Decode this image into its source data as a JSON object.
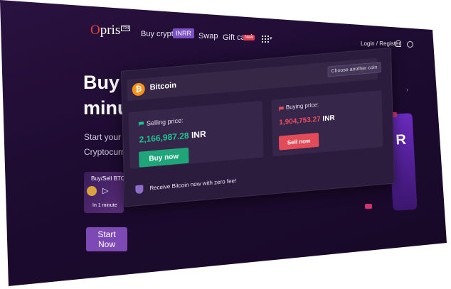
{
  "brand": {
    "logo_first": "O",
    "logo_rest": "pris",
    "logo_tm": "TM"
  },
  "nav": {
    "buy_crypto": "Buy crypto",
    "buy_badge": "INRR",
    "swap": "Swap",
    "gift_card": "Gift card",
    "gift_badge": "New",
    "apps_caret": "▾",
    "login": "Login / Register"
  },
  "hero": {
    "title_line1": "Buy so",
    "title_line2": "minute",
    "sub_line1": "Start your jou",
    "sub_line2": "Cryptocurren",
    "promo_top": "Buy/Sell BTC",
    "promo_bottom": "In 1 minute",
    "start_button": "Start Now"
  },
  "panel": {
    "coin_name": "Bitcoin",
    "coin_symbol": "₿",
    "choose_button": "Choose another coin",
    "selling": {
      "label": "Selling price:",
      "price": "2,166,987.28",
      "currency": "INR",
      "button": "Buy now"
    },
    "buying": {
      "label": "Buying price:",
      "price": "1,904,753.27",
      "currency": "INR",
      "button": "Sell now"
    },
    "zero_fee": "Receive Bitcoin now with zero fee!"
  },
  "decor": {
    "phone_glyph": "R",
    "chevron": "›"
  },
  "colors": {
    "accent": "#7b4fc6",
    "sell_green": "#1fc38f",
    "buy_red": "#ea4d5b",
    "bitcoin": "#f7931a",
    "background": "#1d0b30"
  }
}
